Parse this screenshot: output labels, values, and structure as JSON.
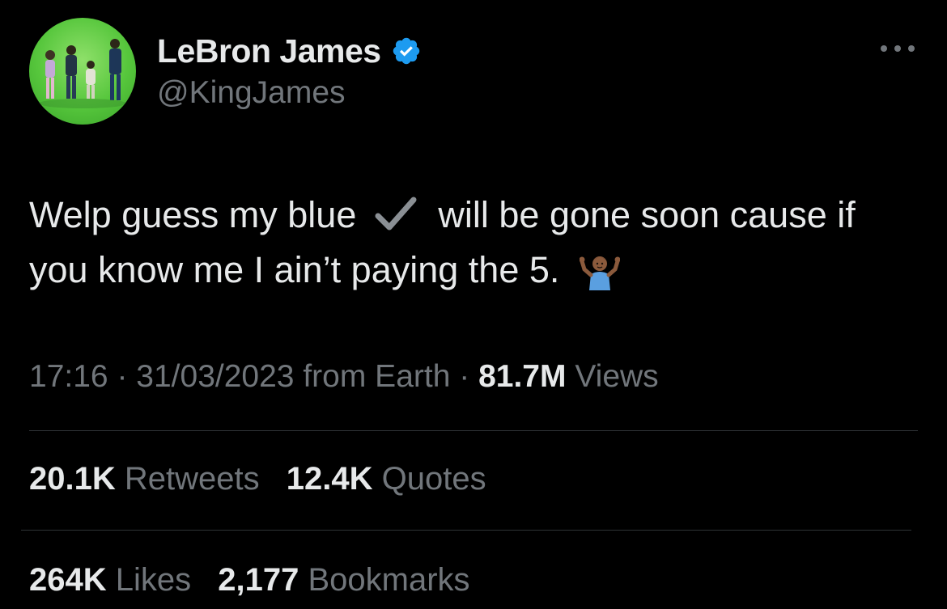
{
  "author": {
    "display_name": "LeBron James",
    "handle": "@KingJames",
    "verified_color": "#1d9bf0"
  },
  "tweet": {
    "text_part1": "Welp guess my blue",
    "text_part2": "will be gone soon cause if you know me I ain’t paying the 5.",
    "check_emoji": "heavy-check-mark-icon",
    "shrug_emoji": "person-shrugging-icon"
  },
  "meta": {
    "time": "17:16",
    "separator": "·",
    "date": "31/03/2023",
    "source": "from Earth",
    "views_count": "81.7M",
    "views_label": "Views"
  },
  "stats": {
    "retweets_count": "20.1K",
    "retweets_label": "Retweets",
    "quotes_count": "12.4K",
    "quotes_label": "Quotes",
    "likes_count": "264K",
    "likes_label": "Likes",
    "bookmarks_count": "2,177",
    "bookmarks_label": "Bookmarks"
  },
  "colors": {
    "background": "#000000",
    "primary_text": "#e7e9ea",
    "secondary_text": "#71767b",
    "divider": "#2f3336",
    "avatar_bg": "#56c63c"
  }
}
